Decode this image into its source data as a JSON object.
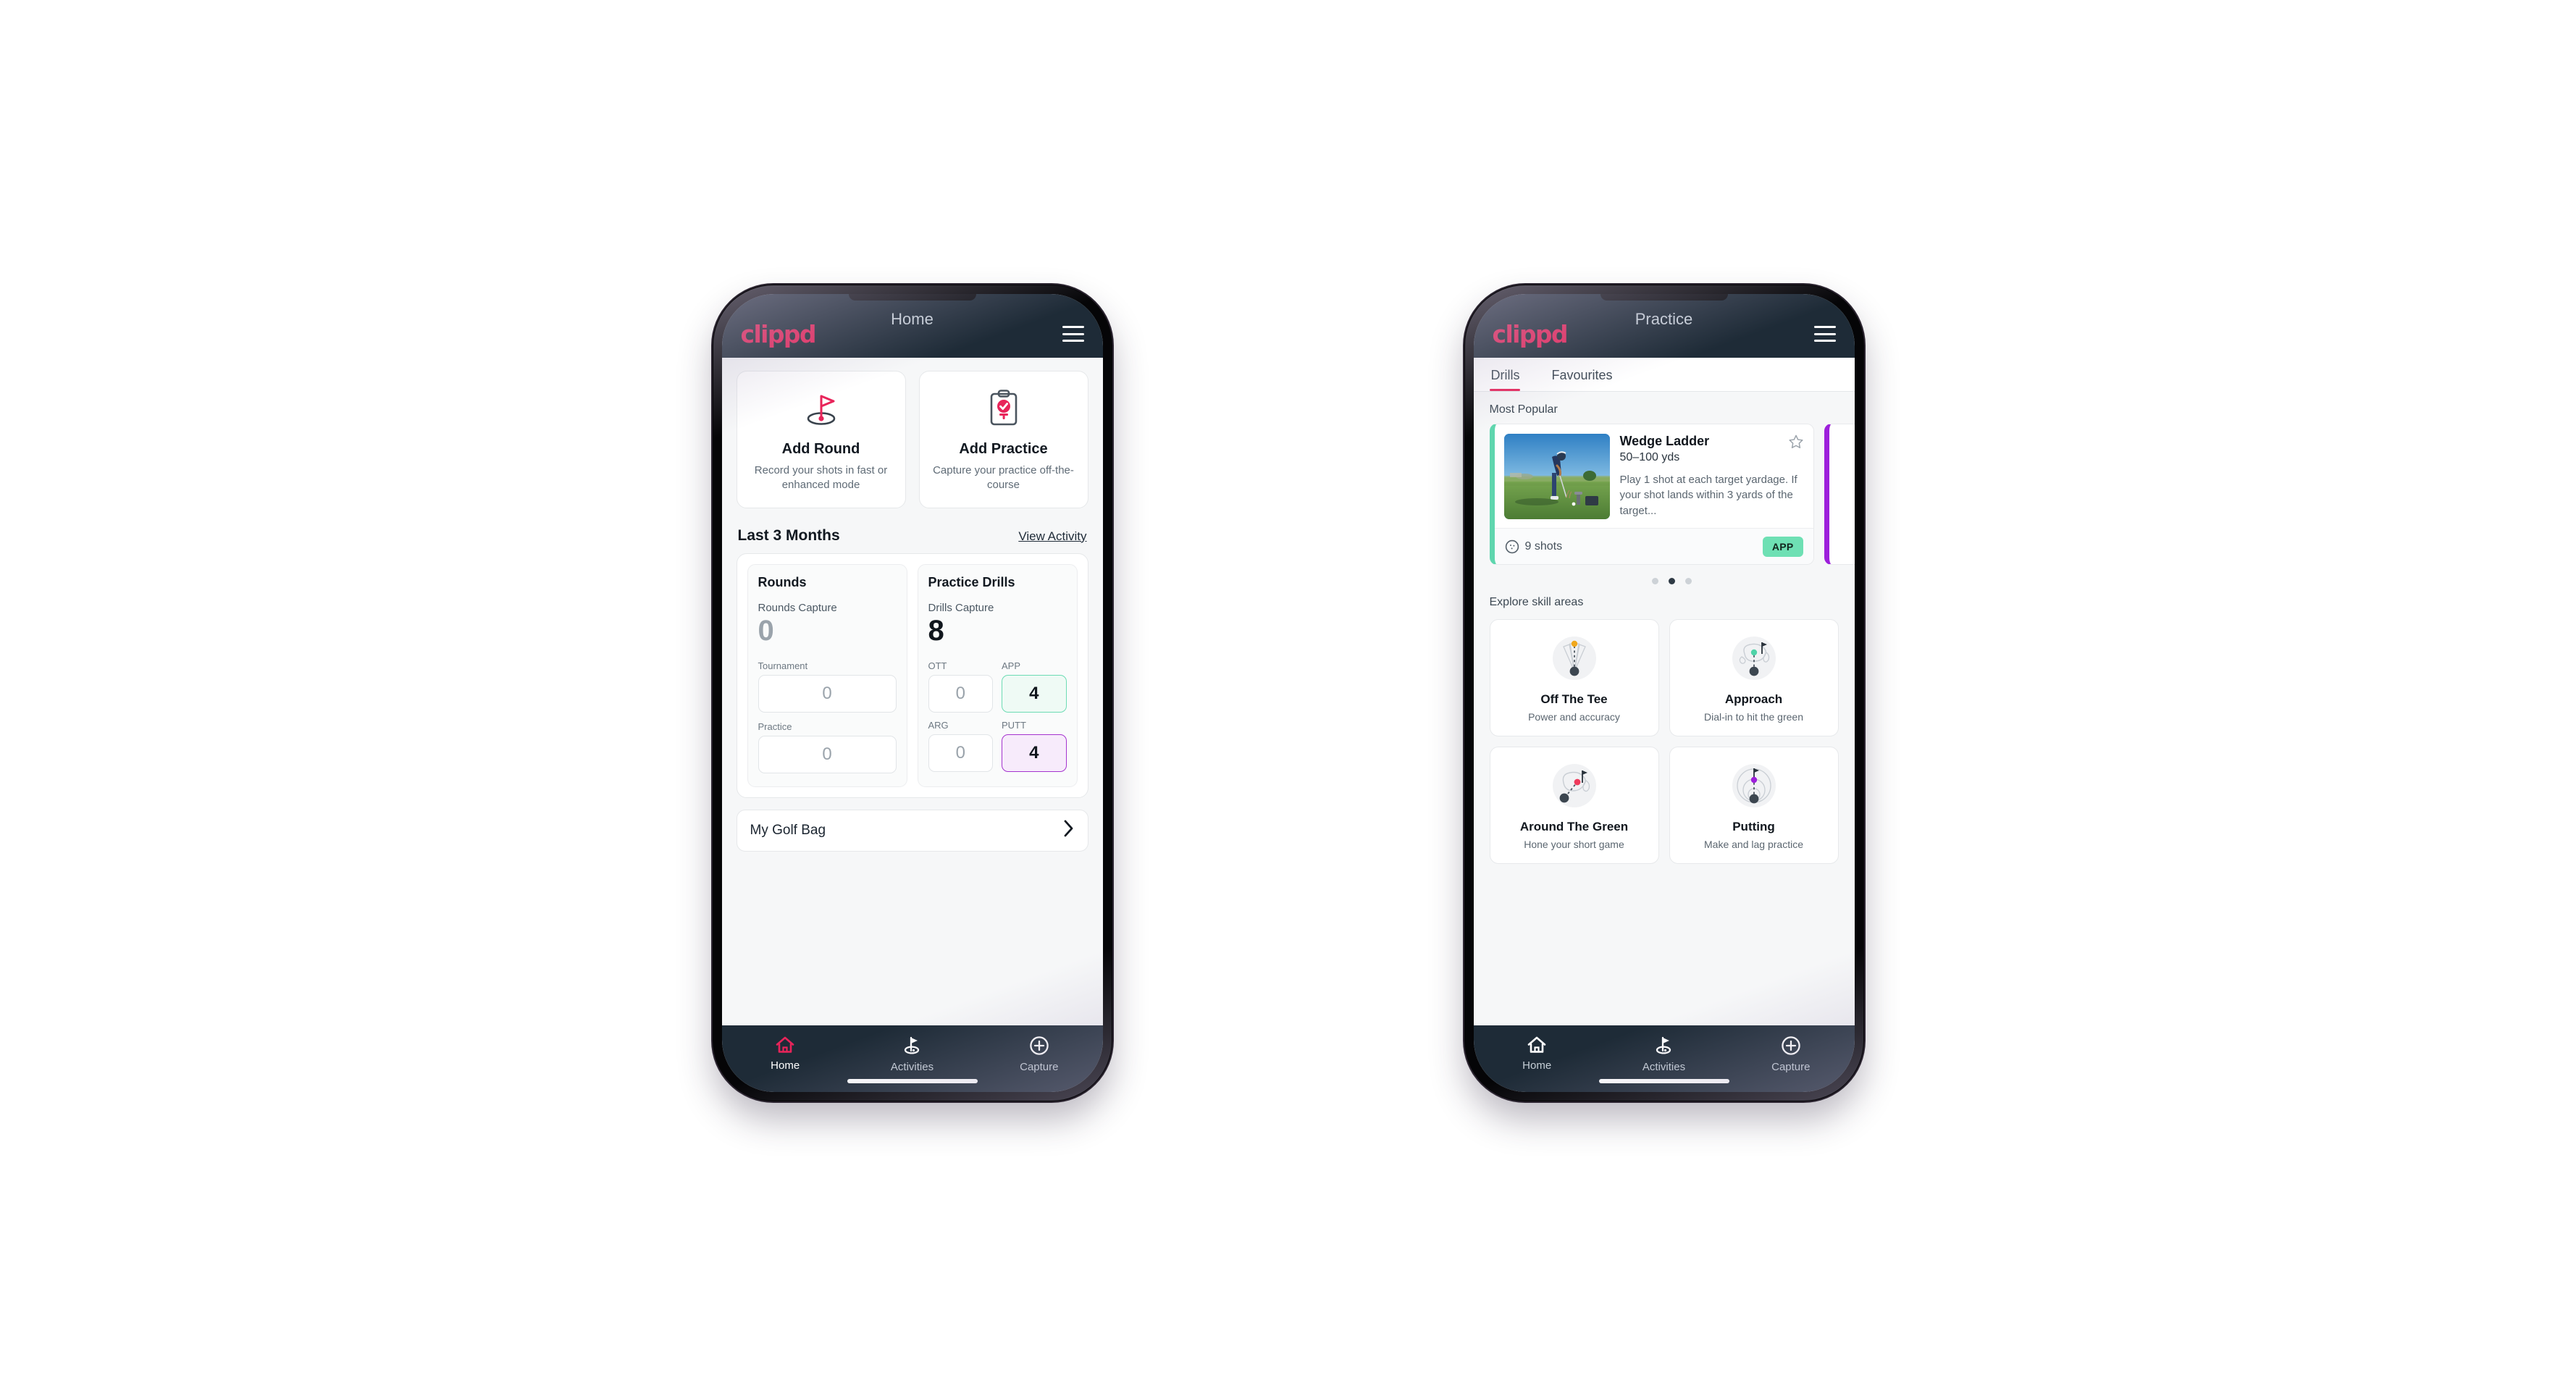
{
  "brand": {
    "logo_text": "clippd",
    "accent_pink": "#e8245a",
    "navy": "#1e2b37",
    "green": "#6ee0b4",
    "purple": "#9d1fdb"
  },
  "home": {
    "appbar": {
      "title": "Home",
      "menu_icon": "hamburger-icon"
    },
    "quick_actions": [
      {
        "icon": "golf-flag-icon",
        "title": "Add Round",
        "subtitle": "Record your shots in fast or enhanced mode"
      },
      {
        "icon": "clipboard-check-icon",
        "title": "Add Practice",
        "subtitle": "Capture your practice off-the-course"
      }
    ],
    "section": {
      "title": "Last 3 Months",
      "link": "View Activity"
    },
    "rounds": {
      "heading": "Rounds",
      "capture_label": "Rounds Capture",
      "capture_value": "0",
      "fields": [
        {
          "label": "Tournament",
          "value": "0",
          "accent": "none"
        },
        {
          "label": "Practice",
          "value": "0",
          "accent": "none"
        }
      ]
    },
    "practice_drills": {
      "heading": "Practice Drills",
      "capture_label": "Drills Capture",
      "capture_value": "8",
      "fields": [
        {
          "label": "OTT",
          "value": "0",
          "accent": "none"
        },
        {
          "label": "APP",
          "value": "4",
          "accent": "green"
        },
        {
          "label": "ARG",
          "value": "0",
          "accent": "none"
        },
        {
          "label": "PUTT",
          "value": "4",
          "accent": "purple"
        }
      ]
    },
    "golf_bag": {
      "label": "My Golf Bag",
      "chevron": "chevron-right-icon"
    },
    "nav": [
      {
        "icon": "home-icon",
        "label": "Home",
        "active": true
      },
      {
        "icon": "golf-activities-icon",
        "label": "Activities",
        "active": false
      },
      {
        "icon": "plus-circle-icon",
        "label": "Capture",
        "active": false
      }
    ]
  },
  "practice": {
    "appbar": {
      "title": "Practice",
      "menu_icon": "hamburger-icon"
    },
    "tabs": [
      {
        "label": "Drills",
        "active": true
      },
      {
        "label": "Favourites",
        "active": false
      }
    ],
    "most_popular_label": "Most Popular",
    "drill": {
      "title": "Wedge Ladder",
      "range": "50–100 yds",
      "description": "Play 1 shot at each target yardage. If your shot lands within 3 yards of the target...",
      "shots": "9 shots",
      "shots_icon": "golf-ball-icon",
      "badge": "APP",
      "star_icon": "star-outline-icon",
      "thumbnail": "golfer-chipping-photo"
    },
    "carousel_dots": [
      false,
      true,
      false
    ],
    "skill_label": "Explore skill areas",
    "skills": [
      {
        "icon": "off-the-tee-icon",
        "name": "Off The Tee",
        "sub": "Power and accuracy"
      },
      {
        "icon": "approach-icon",
        "name": "Approach",
        "sub": "Dial-in to hit the green"
      },
      {
        "icon": "around-the-green-icon",
        "name": "Around The Green",
        "sub": "Hone your short game"
      },
      {
        "icon": "putting-icon",
        "name": "Putting",
        "sub": "Make and lag practice"
      }
    ],
    "nav": [
      {
        "icon": "home-icon",
        "label": "Home",
        "active": false
      },
      {
        "icon": "golf-activities-icon",
        "label": "Activities",
        "active": false
      },
      {
        "icon": "plus-circle-icon",
        "label": "Capture",
        "active": false
      }
    ]
  }
}
